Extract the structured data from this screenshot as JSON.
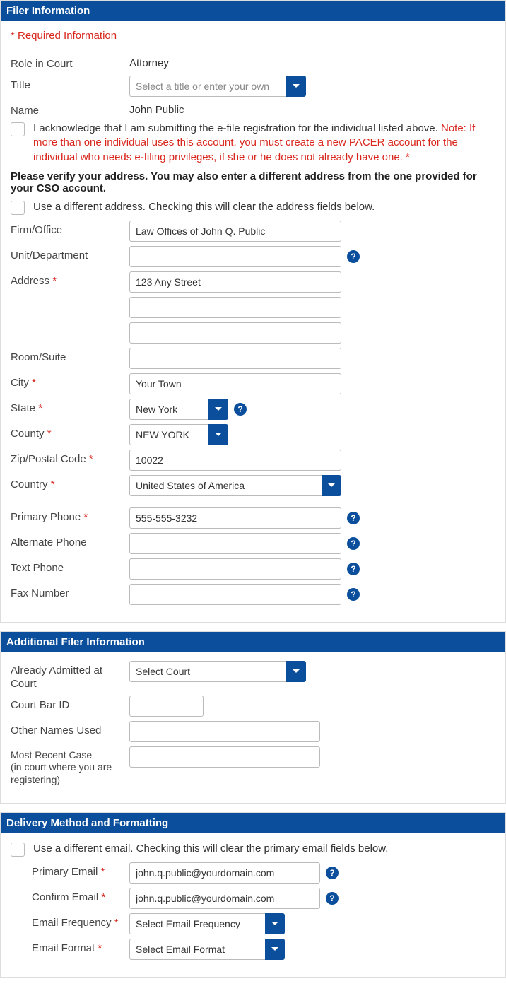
{
  "filer": {
    "header": "Filer Information",
    "required_note": "* Required Information",
    "role_label": "Role in Court",
    "role_value": "Attorney",
    "title_label": "Title",
    "title_placeholder": "Select a title or enter your own",
    "name_label": "Name",
    "name_value": "John Public",
    "ack_text": "I acknowledge that I am submitting the e-file registration for the individual listed above. ",
    "ack_note": "Note: If more than one individual uses this account, you must create a new PACER account for the individual who needs e-filing privileges, if she or he does not already have one. *",
    "verify_text": "Please verify your address. You may also enter a different address from the one provided for your CSO account.",
    "diff_addr_text": "Use a different address. Checking this will clear the address fields below.",
    "firm_label": "Firm/Office",
    "firm_value": "Law Offices of John Q. Public",
    "unit_label": "Unit/Department",
    "unit_value": "",
    "address_label": "Address",
    "address1_value": "123 Any Street",
    "address2_value": "",
    "address3_value": "",
    "room_label": "Room/Suite",
    "room_value": "",
    "city_label": "City",
    "city_value": "Your Town",
    "state_label": "State",
    "state_value": "New York",
    "county_label": "County",
    "county_value": "NEW YORK",
    "zip_label": "Zip/Postal Code",
    "zip_value": "10022",
    "country_label": "Country",
    "country_value": "United States of America",
    "primary_phone_label": "Primary Phone",
    "primary_phone_value": "555-555-3232",
    "alt_phone_label": "Alternate Phone",
    "alt_phone_value": "",
    "text_phone_label": "Text Phone",
    "text_phone_value": "",
    "fax_label": "Fax Number",
    "fax_value": ""
  },
  "additional": {
    "header": "Additional Filer Information",
    "admitted_label": "Already Admitted at Court",
    "admitted_value": "Select Court",
    "bar_id_label": "Court Bar ID",
    "bar_id_value": "",
    "other_names_label": "Other Names Used",
    "other_names_value": "",
    "recent_case_label": "Most Recent Case",
    "recent_case_sub": "(in court where you are registering)",
    "recent_case_value": ""
  },
  "delivery": {
    "header": "Delivery Method and Formatting",
    "diff_email_text": "Use a different email. Checking this will clear the primary email fields below.",
    "primary_email_label": "Primary Email",
    "primary_email_value": "john.q.public@yourdomain.com",
    "confirm_email_label": "Confirm Email",
    "confirm_email_value": "john.q.public@yourdomain.com",
    "freq_label": "Email Frequency",
    "freq_value": "Select Email Frequency",
    "format_label": "Email Format",
    "format_value": "Select Email Format"
  }
}
